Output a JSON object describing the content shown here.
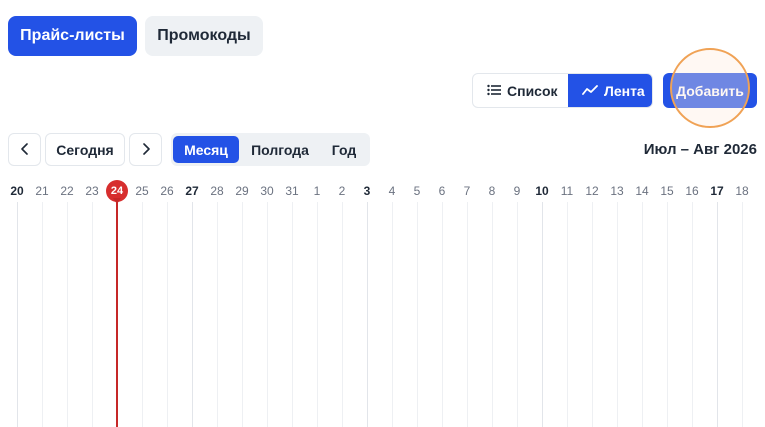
{
  "tabs": {
    "price_lists": "Прайс-листы",
    "promocodes": "Промокоды"
  },
  "view_toggle": {
    "list_label": "Список",
    "feed_label": "Лента",
    "selected": "Лента"
  },
  "add_button": "Добавить",
  "nav": {
    "prev_icon": "‹",
    "today_label": "Сегодня",
    "next_icon": "›"
  },
  "range": {
    "month": "Месяц",
    "half_year": "Полгода",
    "year": "Год",
    "selected": "Месяц"
  },
  "period_title": "Июл – Авг 2026",
  "timeline": {
    "days": [
      {
        "label": "20",
        "bold": true
      },
      {
        "label": "21",
        "bold": false
      },
      {
        "label": "22",
        "bold": false
      },
      {
        "label": "23",
        "bold": false
      },
      {
        "label": "24",
        "bold": false,
        "today": true
      },
      {
        "label": "25",
        "bold": false
      },
      {
        "label": "26",
        "bold": false
      },
      {
        "label": "27",
        "bold": true
      },
      {
        "label": "28",
        "bold": false
      },
      {
        "label": "29",
        "bold": false
      },
      {
        "label": "30",
        "bold": false
      },
      {
        "label": "31",
        "bold": false
      },
      {
        "label": "1",
        "bold": false
      },
      {
        "label": "2",
        "bold": false
      },
      {
        "label": "3",
        "bold": true
      },
      {
        "label": "4",
        "bold": false
      },
      {
        "label": "5",
        "bold": false
      },
      {
        "label": "6",
        "bold": false
      },
      {
        "label": "7",
        "bold": false
      },
      {
        "label": "8",
        "bold": false
      },
      {
        "label": "9",
        "bold": false
      },
      {
        "label": "10",
        "bold": true
      },
      {
        "label": "11",
        "bold": false
      },
      {
        "label": "12",
        "bold": false
      },
      {
        "label": "13",
        "bold": false
      },
      {
        "label": "14",
        "bold": false
      },
      {
        "label": "15",
        "bold": false
      },
      {
        "label": "16",
        "bold": false
      },
      {
        "label": "17",
        "bold": true
      },
      {
        "label": "18",
        "bold": false
      }
    ]
  },
  "colors": {
    "accent": "#2352e6",
    "today": "#d72e2e",
    "highlight": "#f0a255"
  }
}
